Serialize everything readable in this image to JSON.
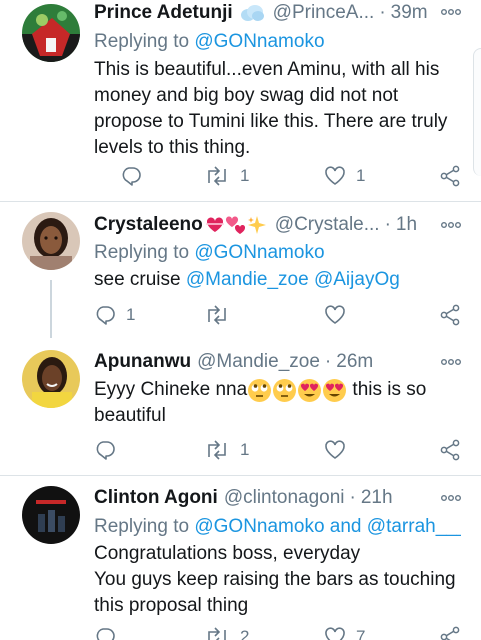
{
  "tweets": [
    {
      "name": "Prince Adetunji",
      "handle": "@PrinceA...",
      "time": "39m",
      "reply_prefix": "Replying to ",
      "reply_to": "@GONnamoko",
      "reply_more": "",
      "reply_to_2": "",
      "text_lines": [
        "This is beautiful...even Aminu, with all his money and big boy swag did not not propose to Tumini like this. There are truly levels to this thing."
      ],
      "replies": "",
      "retweets": "1",
      "likes": "1"
    },
    {
      "name": "Crystaleeno",
      "handle": "@Crystale...",
      "time": "1h",
      "reply_prefix": "Replying to ",
      "reply_to": "@GONnamoko",
      "text_pre": "see cruise ",
      "text_mention_1": "@Mandie_zoe",
      "text_mention_2": "@AijayOg",
      "replies": "1",
      "retweets": "",
      "likes": ""
    },
    {
      "name": "Apunanwu",
      "handle": "@Mandie_zoe",
      "time": "26m",
      "text_pre": "Eyyy Chineke nna ",
      "text_post": " this is so",
      "text_line2": "beautiful",
      "replies": "",
      "retweets": "1",
      "likes": ""
    },
    {
      "name": "Clinton Agoni",
      "handle": "@clintonagoni",
      "time": "21h",
      "reply_prefix": "Replying to ",
      "reply_to": "@GONnamoko",
      "reply_and": " and ",
      "reply_to_2": "@tarrah___",
      "line1": "Congratulations boss, everyday",
      "line2": "You guys keep raising the bars as touching this proposal thing",
      "replies": "",
      "retweets": "2",
      "likes": "7"
    }
  ],
  "separator": "·",
  "colors": {
    "text": "#14171a",
    "secondary": "#657786",
    "link": "#1b95e0",
    "divider": "#dde3e7",
    "heart_emoji": "#e0245e",
    "sparkle": "#ffcc4d"
  },
  "icons": {
    "reply": "reply-icon",
    "retweet": "retweet-icon",
    "like": "heart-icon",
    "share": "share-icon",
    "more": "more-icon"
  }
}
